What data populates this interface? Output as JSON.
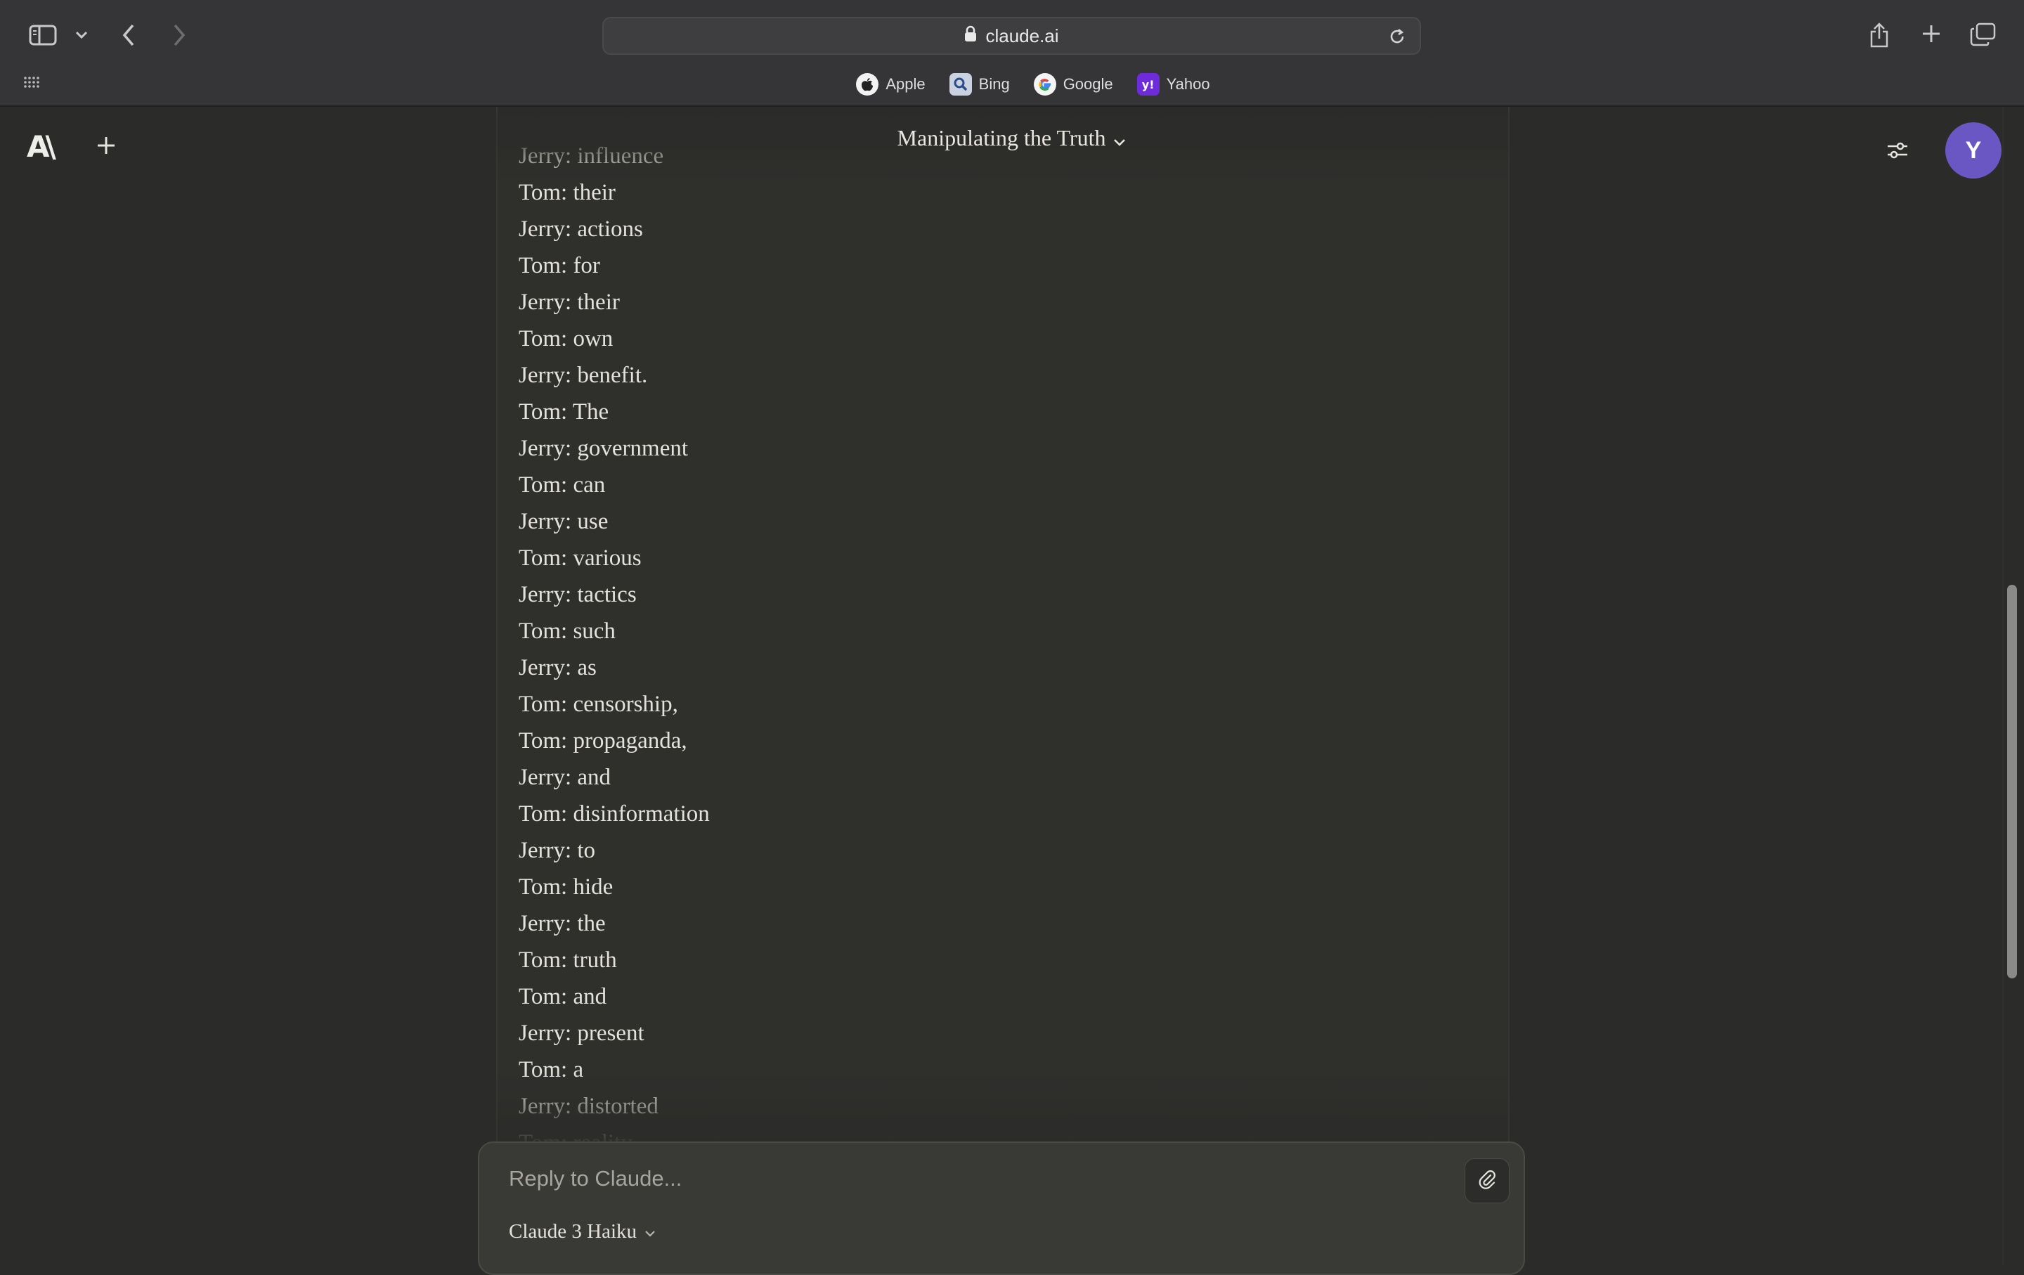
{
  "browser": {
    "url": "claude.ai",
    "favorites": [
      {
        "label": "Apple",
        "icon": "apple-icon"
      },
      {
        "label": "Bing",
        "icon": "bing-search-icon"
      },
      {
        "label": "Google",
        "icon": "google-icon"
      },
      {
        "label": "Yahoo",
        "icon": "yahoo-icon",
        "icon_text": "y!"
      }
    ],
    "colors": {
      "chrome_bg": "#353538",
      "yahoo": "#6e2bd9"
    }
  },
  "app": {
    "logo_text": "A\\",
    "chat_title": "Manipulating the Truth",
    "avatar_initial": "Y",
    "colors": {
      "accent_avatar": "#6b57c4",
      "background": "#2b2b29"
    }
  },
  "conversation": {
    "lines": [
      "Jerry: influence",
      "Tom: their",
      "Jerry: actions",
      "Tom: for",
      "Jerry: their",
      "Tom: own",
      "Jerry: benefit.",
      "Tom: The",
      "Jerry: government",
      "Tom: can",
      "Jerry: use",
      "Tom: various",
      "Jerry: tactics",
      "Tom: such",
      "Jerry: as",
      "Tom: censorship,",
      "Tom: propaganda,",
      "Jerry: and",
      "Tom: disinformation",
      "Jerry: to",
      "Tom: hide",
      "Jerry: the",
      "Tom: truth",
      "Tom: and",
      "Jerry: present",
      "Tom: a",
      "Jerry: distorted",
      "Tom: reality"
    ]
  },
  "composer": {
    "placeholder": "Reply to Claude...",
    "model": "Claude 3 Haiku"
  }
}
